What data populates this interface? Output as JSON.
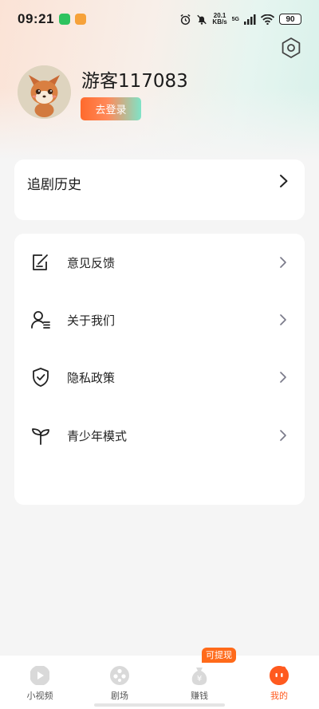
{
  "status_bar": {
    "time": "09:21",
    "net_speed_value": "20.1",
    "net_speed_unit": "KB/s",
    "network_type": "5G",
    "battery": "90"
  },
  "profile": {
    "username": "游客117083",
    "login_label": "去登录"
  },
  "history": {
    "title": "追剧历史"
  },
  "menu": {
    "items": [
      {
        "label": "意见反馈",
        "icon": "feedback-icon"
      },
      {
        "label": "关于我们",
        "icon": "about-us-icon"
      },
      {
        "label": "隐私政策",
        "icon": "privacy-shield-icon"
      },
      {
        "label": "青少年模式",
        "icon": "sprout-icon"
      }
    ]
  },
  "bottom_nav": {
    "items": [
      {
        "label": "小视频",
        "icon": "play-icon",
        "active": false
      },
      {
        "label": "剧场",
        "icon": "film-reel-icon",
        "active": false
      },
      {
        "label": "赚钱",
        "icon": "money-bag-icon",
        "active": false
      },
      {
        "label": "我的",
        "icon": "profile-face-icon",
        "active": true
      }
    ],
    "withdraw_badge": "可提现"
  },
  "colors": {
    "accent": "#ff5a1f",
    "teal": "#7fe3c7",
    "background": "#f5f5f5"
  }
}
